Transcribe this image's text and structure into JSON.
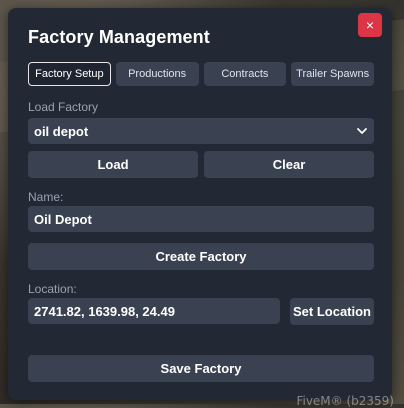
{
  "window": {
    "title": "Factory Management",
    "close_label": "×"
  },
  "tabs": [
    {
      "label": "Factory Setup",
      "active": true
    },
    {
      "label": "Productions",
      "active": false
    },
    {
      "label": "Contracts",
      "active": false
    },
    {
      "label": "Trailer Spawns",
      "active": false
    }
  ],
  "load": {
    "label": "Load Factory",
    "selected": "oil depot",
    "load_button": "Load",
    "clear_button": "Clear"
  },
  "name": {
    "label": "Name:",
    "value": "Oil Depot",
    "create_button": "Create Factory"
  },
  "location": {
    "label": "Location:",
    "value": "2741.82, 1639.98, 24.49",
    "set_button": "Set Location"
  },
  "save_button": "Save Factory",
  "watermark": "FiveM® (b2359)",
  "colors": {
    "panel": "#222834",
    "control": "#3a4252",
    "close": "#dc3545",
    "label": "#9aa3b1"
  }
}
